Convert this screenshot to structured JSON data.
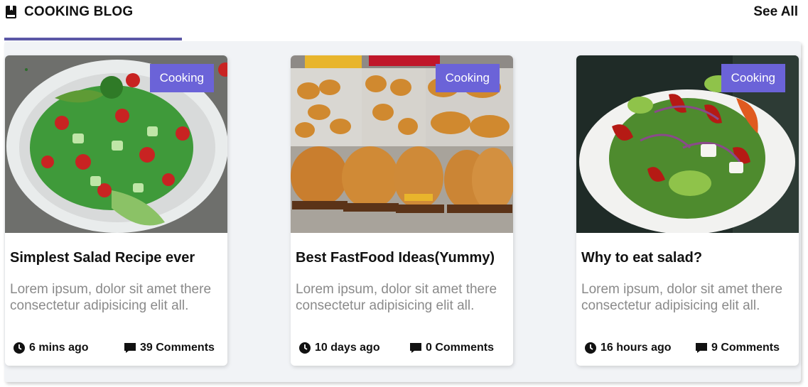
{
  "header": {
    "title": "COOKING BLOG",
    "see_all": "See All",
    "accent_color": "#5b57a6"
  },
  "posts": [
    {
      "category": "Cooking",
      "title": "Simplest Salad Recipe ever",
      "excerpt": "Lorem ipsum, dolor sit amet there consectetur adipisicing elit all.",
      "time": "6 mins ago",
      "comments": "39 Comments",
      "image_icon": "salad-photo"
    },
    {
      "category": "Cooking",
      "title": "Best FastFood Ideas(Yummy)",
      "excerpt": "Lorem ipsum, dolor sit amet there consectetur adipisicing elit all.",
      "time": "10 days ago",
      "comments": "0 Comments",
      "image_icon": "fastfood-photo"
    },
    {
      "category": "Cooking",
      "title": "Why to eat salad?",
      "excerpt": "Lorem ipsum, dolor sit amet there consectetur adipisicing elit all.",
      "time": "16 hours ago",
      "comments": "9 Comments",
      "image_icon": "salad-bowl-photo"
    }
  ],
  "colors": {
    "tag_bg": "#6b63d8",
    "excerpt": "#8a8a8a",
    "panel_bg": "#f1f3f6"
  }
}
